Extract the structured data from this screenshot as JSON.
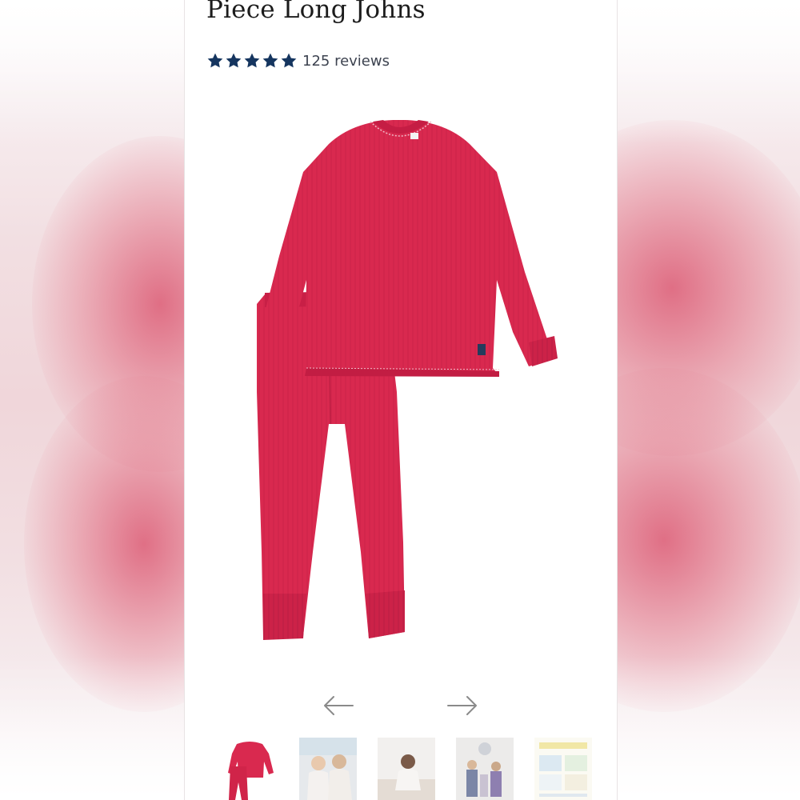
{
  "product": {
    "title": "Piece Long Johns",
    "rating": 5,
    "reviews_label": "125 reviews",
    "main_image_icon": "red-thermal-long-johns-set"
  },
  "colors": {
    "star": "#15355f",
    "garment": "#d9294f",
    "arrow": "#8a8a8a"
  },
  "carousel": {
    "prev_icon": "arrow-left-icon",
    "next_icon": "arrow-right-icon"
  },
  "thumbnails": [
    {
      "icon": "red-long-johns-thumbnail"
    },
    {
      "icon": "kids-lifestyle-photo-thumbnail"
    },
    {
      "icon": "child-sitting-photo-thumbnail"
    },
    {
      "icon": "kids-standing-photo-thumbnail"
    },
    {
      "icon": "size-chart-thumbnail"
    }
  ]
}
